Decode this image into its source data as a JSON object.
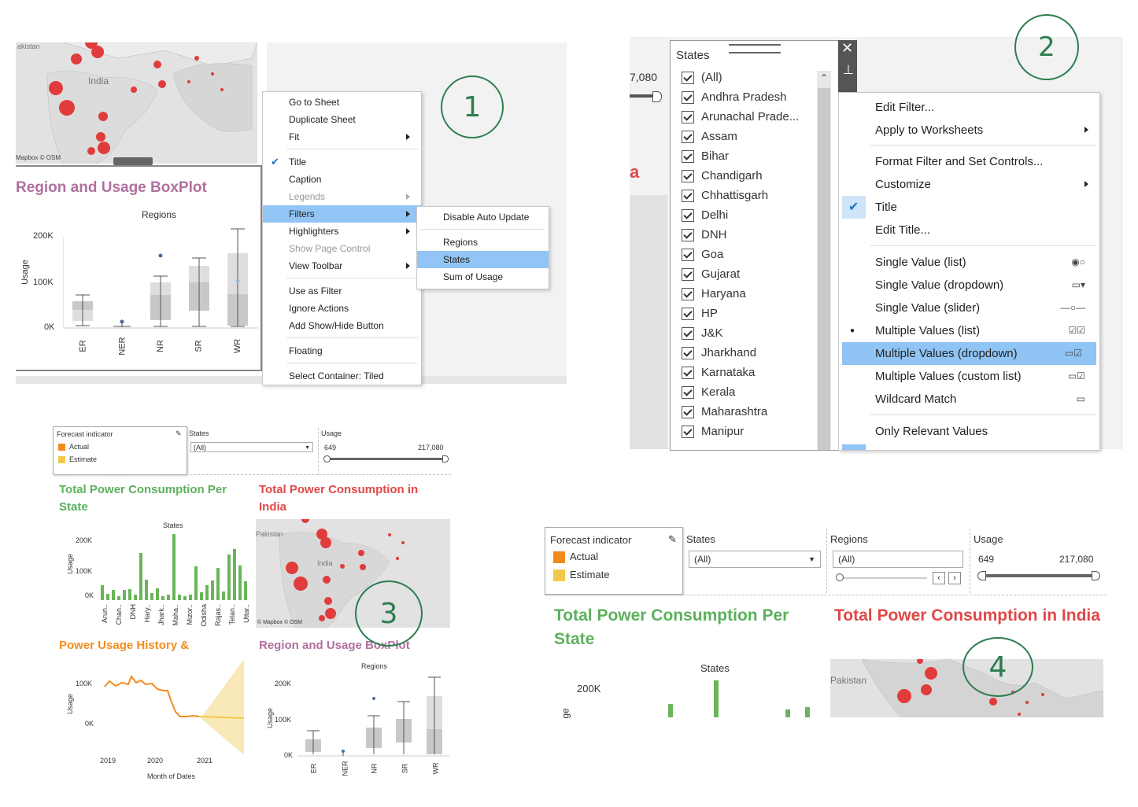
{
  "panel1": {
    "map_labels": {
      "country_top": "akistan",
      "country": "India",
      "credit": "Mapbox © OSM"
    },
    "title": "Region and Usage BoxPlot",
    "column_header": "Regions",
    "y_axis_label": "Usage",
    "y_ticks": [
      "200K",
      "100K",
      "0K"
    ],
    "x_ticks": [
      "ER",
      "NER",
      "NR",
      "SR",
      "WR"
    ],
    "context_menu": [
      "Go to Sheet",
      "Duplicate Sheet",
      "Fit",
      "Title",
      "Caption",
      "Legends",
      "Filters",
      "Highlighters",
      "Show Page Control",
      "View Toolbar",
      "Use as Filter",
      "Ignore Actions",
      "Add Show/Hide Button",
      "Floating",
      "Select Container: Tiled"
    ],
    "filters_submenu": [
      "Disable Auto Update",
      "Regions",
      "States",
      "Sum of Usage"
    ]
  },
  "panel2": {
    "filter_title": "States",
    "left_value": "7,080",
    "left_char": "a",
    "states": [
      "(All)",
      "Andhra Pradesh",
      "Arunachal Prade...",
      "Assam",
      "Bihar",
      "Chandigarh",
      "Chhattisgarh",
      "Delhi",
      "DNH",
      "Goa",
      "Gujarat",
      "Haryana",
      "HP",
      "J&K",
      "Jharkhand",
      "Karnataka",
      "Kerala",
      "Maharashtra",
      "Manipur"
    ],
    "menu": [
      "Edit Filter...",
      "Apply to Worksheets",
      "Format Filter and Set Controls...",
      "Customize",
      "Title",
      "Edit Title...",
      "Single Value (list)",
      "Single Value (dropdown)",
      "Single Value (slider)",
      "Multiple Values (list)",
      "Multiple Values (dropdown)",
      "Multiple Values (custom list)",
      "Wildcard Match",
      "Only Relevant Values"
    ]
  },
  "panel3": {
    "legend_title": "Forecast indicator",
    "legend_items": [
      "Actual",
      "Estimate"
    ],
    "states_label": "States",
    "states_value": "(All)",
    "usage_label": "Usage",
    "usage_min": "649",
    "usage_max": "217,080",
    "title_bar": "Total Power Consumption Per State",
    "title_map": "Total Power Consumption in India",
    "title_history": "Power Usage History &",
    "title_box": "Region and Usage BoxPlot",
    "bar_header": "States",
    "bar_ylabel": "Usage",
    "bar_yticks": [
      "200K",
      "100K",
      "0K"
    ],
    "bar_xticks": [
      "Arun..",
      "Chan..",
      "DNH",
      "Hary..",
      "Jhark..",
      "Maha..",
      "Mizor..",
      "Odisha",
      "Rajas..",
      "Telan..",
      "Uttar.."
    ],
    "map_labels": {
      "country_top": "Pakistan",
      "country": "India",
      "credit": "© Mapbox © OSM"
    },
    "line_ylabel": "Usage",
    "line_yticks": [
      "100K",
      "0K"
    ],
    "line_xticks": [
      "2019",
      "2020",
      "2021"
    ],
    "line_xlabel": "Month of Dates",
    "box_header": "Regions",
    "box_ylabel": "Usage",
    "box_yticks": [
      "200K",
      "100K",
      "0K"
    ],
    "box_xticks": [
      "ER",
      "NER",
      "NR",
      "SR",
      "WR"
    ]
  },
  "panel4": {
    "legend_title": "Forecast indicator",
    "legend_items": [
      "Actual",
      "Estimate"
    ],
    "states_label": "States",
    "states_value": "(All)",
    "regions_label": "Regions",
    "regions_value": "(All)",
    "usage_label": "Usage",
    "usage_min": "649",
    "usage_max": "217,080",
    "title_bar": "Total Power Consumption Per State",
    "title_map": "Total Power Consumption in India",
    "bar_header": "States",
    "bar_ytick": "200K",
    "bar_ylabel_fragment": "ge",
    "map_label": "Pakistan"
  },
  "annotations": [
    "1",
    "2",
    "3",
    "4"
  ],
  "colors": {
    "actual": "#f28b1e",
    "estimate": "#f2c94c",
    "bars": "#6ab55b",
    "map_dots": "#e03c3c",
    "annotation": "#2e7d4f",
    "menu_highlight": "#92c5f5"
  }
}
